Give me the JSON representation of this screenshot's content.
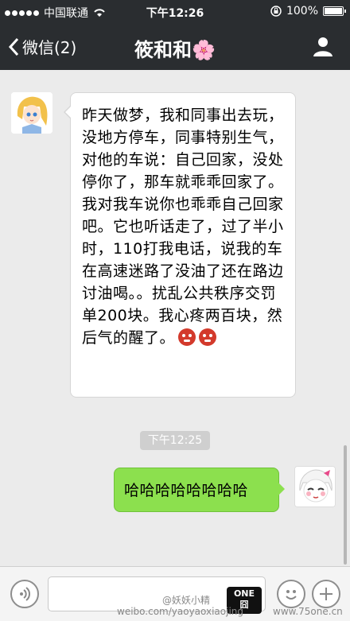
{
  "status_bar": {
    "carrier": "中国联通",
    "time": "下午12:26",
    "battery": "100%"
  },
  "nav": {
    "back_label": "微信(2)",
    "title": "筱和和",
    "title_decoration": "🌸"
  },
  "messages": {
    "incoming_text": "昨天做梦，我和同事出去玩，没地方停车，同事特别生气，对他的车说：自己回家，没处停你了，那车就乖乖回家了。我对我车说你也乖乖自己回家吧。它也听话走了，过了半小时，110打我电话，说我的车在高速迷路了没油了还在路边讨油喝。。扰乱公共秩序交罚单200块。我心疼两百块，然后气的醒了。",
    "timestamp": "下午12:25",
    "outgoing_text": "哈哈哈哈哈哈哈哈"
  },
  "watermark": {
    "weibo_handle": "@妖妖小精",
    "weibo_url": "weibo.com/yaoyaoxiaojing",
    "site_url": "www.75one.cn",
    "badge_top": "ONE",
    "badge_bottom": "囧"
  },
  "icons": {
    "back": "chevron-left-icon",
    "profile": "person-icon",
    "wifi": "wifi-icon",
    "lock": "orientation-lock-icon",
    "voice": "voice-icon",
    "emoji": "emoji-face-icon",
    "more": "plus-icon"
  },
  "colors": {
    "nav_bg": "#2a2d30",
    "chat_bg": "#ebebeb",
    "outgoing_bubble": "#8ce04e"
  }
}
